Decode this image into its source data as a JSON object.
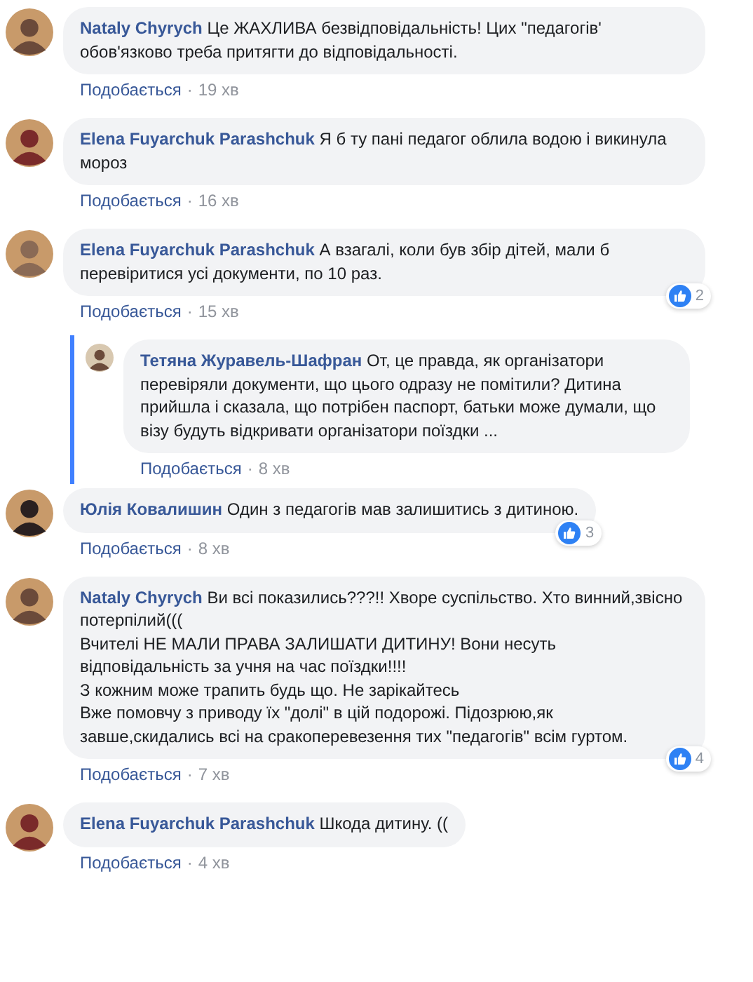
{
  "comments": [
    {
      "author": "Nataly Chyrych",
      "text": "Це ЖАХЛИВА безвідповідальність! Цих \"педагогів' обов'язково треба притягти до відповідальності.",
      "like_label": "Подобається",
      "separator": "·",
      "time": "19 хв"
    },
    {
      "author": "Elena Fuyarchuk Parashchuk",
      "text": "Я б ту пані педагог облила водою і викинула мороз",
      "like_label": "Подобається",
      "separator": "·",
      "time": "16 хв"
    },
    {
      "author": "Elena Fuyarchuk Parashchuk",
      "text": "А взагалі, коли був збір дітей, мали б перевіритися усі документи, по 10 раз.",
      "like_label": "Подобається",
      "separator": "·",
      "time": "15 хв",
      "reactions": "2",
      "replies": [
        {
          "author": "Тетяна Журавель-Шафран",
          "text": "От, це правда, як організатори перевіряли документи, що цього одразу не помітили? Дитина прийшла і сказала, що потрібен паспорт, батьки може думали, що візу будуть відкривати організатори поїздки ...",
          "like_label": "Подобається",
          "separator": "·",
          "time": "8 хв"
        }
      ]
    },
    {
      "author": "Юлія Ковалишин",
      "text": "Один з педагогів мав залишитись з дитиною.",
      "like_label": "Подобається",
      "separator": "·",
      "time": "8 хв",
      "reactions": "3"
    },
    {
      "author": "Nataly Chyrych",
      "text": "Ви всі показились???!! Хворе суспільство. Хто винний,звісно потерпілий(((\nВчителі НЕ МАЛИ ПРАВА ЗАЛИШАТИ ДИТИНУ! Вони несуть відповідальність за учня на час поїздки!!!!\nЗ кожним може трапить будь що. Не зарікайтесь\nВже помовчу з приводу їх \"долі\" в цій подорожі. Підозрюю,як завше,скидались всі на сракоперевезення тих \"педагогів\" всім гуртом.",
      "like_label": "Подобається",
      "separator": "·",
      "time": "7 хв",
      "reactions": "4"
    },
    {
      "author": "Elena Fuyarchuk Parashchuk",
      "text": "Шкода дитину. ((",
      "like_label": "Подобається",
      "separator": "·",
      "time": "4 хв"
    }
  ]
}
